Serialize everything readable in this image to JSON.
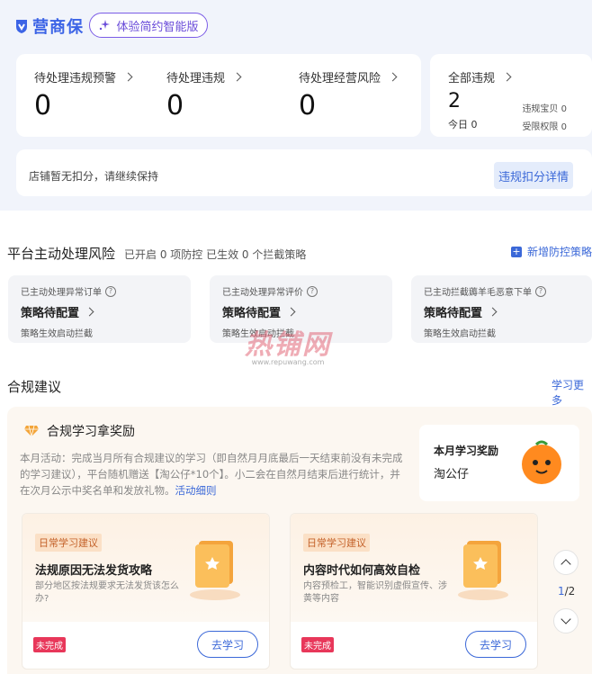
{
  "header": {
    "logo_text": "营商保",
    "experience_button": "体验简约智能版"
  },
  "stats": [
    {
      "label": "待处理违规预警",
      "value": "0"
    },
    {
      "label": "待处理违规",
      "value": "0"
    },
    {
      "label": "待处理经营风险",
      "value": "0"
    }
  ],
  "all_violations": {
    "label": "全部违规",
    "value": "2",
    "today_label": "今日",
    "today_value": "0",
    "item_label": "违规宝贝",
    "item_value": "0",
    "limit_label": "受限权限",
    "limit_value": "0"
  },
  "notice": {
    "text": "店铺暂无扣分，请继续保持",
    "button": "违规扣分详情"
  },
  "risk": {
    "title": "平台主动处理风险",
    "summary": "已开启 0 项防控 已生效 0 个拦截策略",
    "new_button": "新增防控策略",
    "cards": [
      {
        "label": "已主动处理异常订单",
        "status": "策略待配置",
        "desc": "策略生效启动拦截"
      },
      {
        "label": "已主动处理异常评价",
        "status": "策略待配置",
        "desc": "策略生效启动拦截"
      },
      {
        "label": "已主动拦截薅羊毛恶意下单",
        "status": "策略待配置",
        "desc": "策略生效启动拦截"
      }
    ]
  },
  "watermark": {
    "main": "热铺网",
    "url": "www.repuwang.com"
  },
  "compliance": {
    "title": "合规建议",
    "learn_more": "学习更多",
    "reward_heading": "合规学习拿奖励",
    "activity_text": "本月活动：完成当月所有合规建议的学习（即自然月月底最后一天结束前没有未完成的学习建议），平台随机赠送【淘公仔*10个】。小二会在自然月结束后进行统计，并在次月公示中奖名单和发放礼物。",
    "activity_link": "活动细则",
    "reward_title": "本月学习奖励",
    "reward_value": "淘公仔",
    "cards": [
      {
        "tag": "日常学习建议",
        "title": "法规原因无法发货攻略",
        "desc": "部分地区按法规要求无法发货该怎么办?",
        "status": "未完成",
        "button": "去学习"
      },
      {
        "tag": "日常学习建议",
        "title": "内容时代如何高效自检",
        "desc": "内容预检工，智能识别虚假宣传、涉黄等内容",
        "status": "未完成",
        "button": "去学习"
      }
    ],
    "pager_current": "1",
    "pager_total": "/2"
  },
  "colors": {
    "accent": "#3b68d8",
    "brand": "#3c64e6",
    "danger": "#e8375a"
  }
}
